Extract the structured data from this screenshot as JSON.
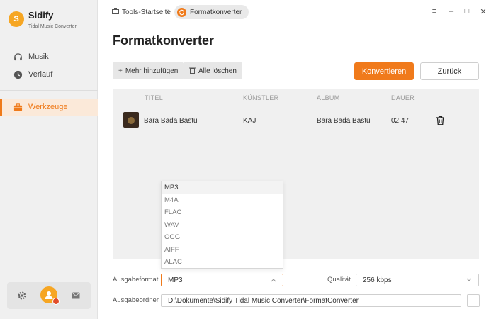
{
  "app": {
    "name": "Sidify",
    "subtitle": "Tidal Music Converter",
    "logo_glyph": "S"
  },
  "sidebar": {
    "items": [
      {
        "label": "Musik",
        "icon": "headphones-icon"
      },
      {
        "label": "Verlauf",
        "icon": "clock-icon"
      },
      {
        "label": "Werkzeuge",
        "icon": "toolbox-icon",
        "active": true
      }
    ]
  },
  "breadcrumb": {
    "home": "Tools-Startseite",
    "separator": "›",
    "current": "Formatkonverter"
  },
  "window_controls": {
    "menu": "≡",
    "minimize": "–",
    "maximize": "□",
    "close": "✕"
  },
  "page": {
    "title": "Formatkonverter"
  },
  "toolbar": {
    "add_label": "Mehr hinzufügen",
    "clear_label": "Alle löschen",
    "convert_label": "Konvertieren",
    "back_label": "Zurück"
  },
  "table": {
    "headers": {
      "title": "TITEL",
      "artist": "KÜNSTLER",
      "album": "ALBUM",
      "duration": "DAUER"
    },
    "rows": [
      {
        "title": "Bara Bada Bastu",
        "artist": "KAJ",
        "album": "Bara Bada Bastu",
        "duration": "02:47"
      }
    ]
  },
  "format_dropdown": {
    "options": [
      "MP3",
      "M4A",
      "FLAC",
      "WAV",
      "OGG",
      "AIFF",
      "ALAC"
    ],
    "selected": "MP3"
  },
  "settings": {
    "format_label": "Ausgabeformat",
    "format_value": "MP3",
    "quality_label": "Qualität",
    "quality_value": "256 kbps",
    "folder_label": "Ausgabeordner",
    "folder_value": "D:\\Dokumente\\Sidify Tidal Music Converter\\FormatConverter",
    "more_label": "···"
  },
  "colors": {
    "accent": "#f07a1b",
    "brand": "#f6a623",
    "sidebar_bg": "#f0f0f0",
    "active_bg": "#fbe9d9"
  }
}
